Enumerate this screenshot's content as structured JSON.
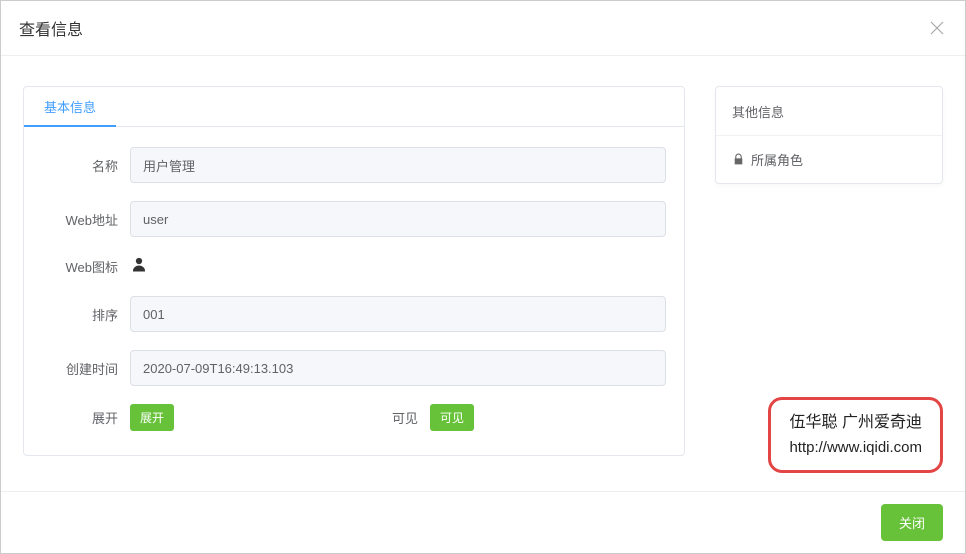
{
  "dialog": {
    "title": "查看信息"
  },
  "tab": {
    "basic": "基本信息"
  },
  "labels": {
    "name": "名称",
    "webAddr": "Web地址",
    "webIcon": "Web图标",
    "sort": "排序",
    "createTime": "创建时间",
    "expand": "展开",
    "visible": "可见"
  },
  "values": {
    "name": "用户管理",
    "webAddr": "user",
    "sort": "001",
    "createTime": "2020-07-09T16:49:13.103",
    "expandTag": "展开",
    "visibleTag": "可见"
  },
  "sidebar": {
    "other": "其他信息",
    "roles": "所属角色"
  },
  "watermark": {
    "name": "伍华聪 广州爱奇迪",
    "url": "http://www.iqidi.com"
  },
  "footer": {
    "close": "关闭"
  },
  "colors": {
    "primary": "#409eff",
    "success": "#67c23a",
    "danger": "#e34545"
  }
}
